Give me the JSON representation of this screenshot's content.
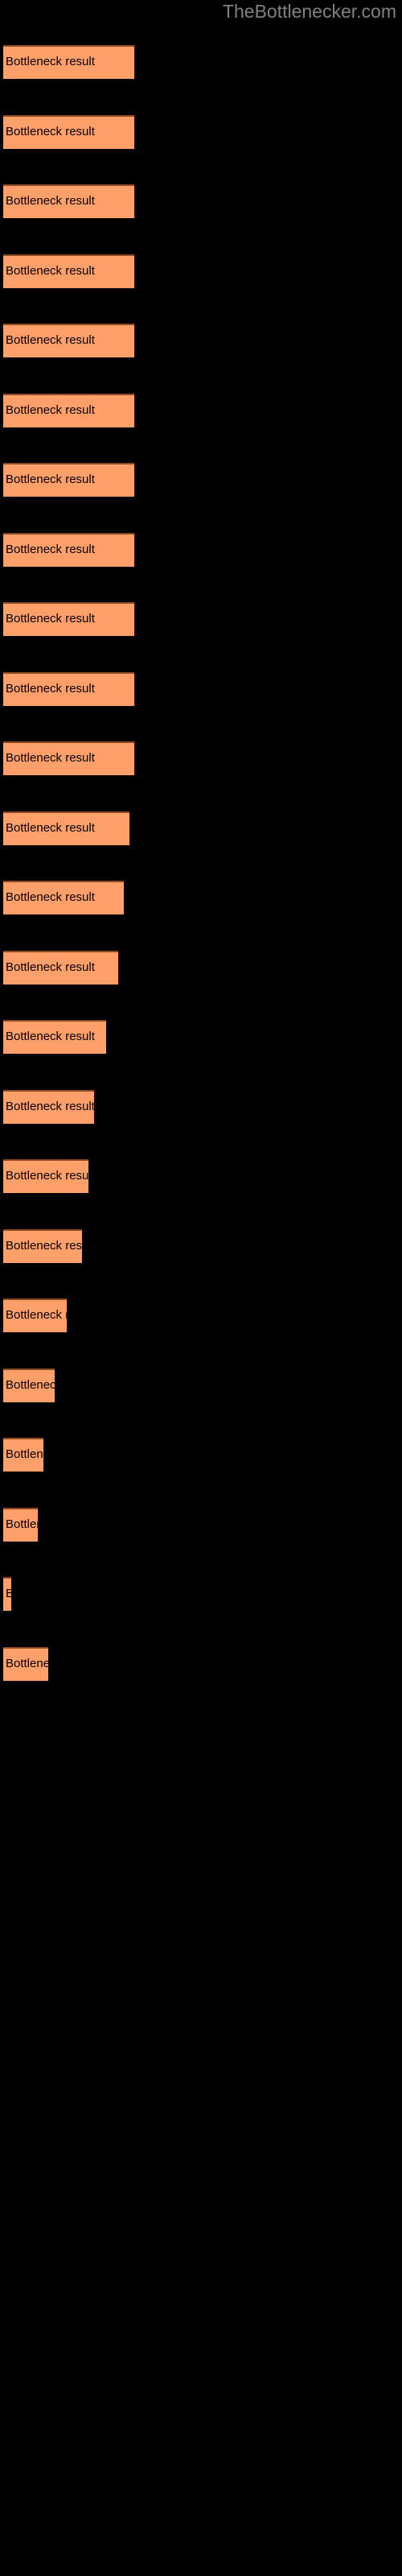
{
  "site": {
    "title": "TheBottlenecker.com",
    "title_color": "#808080",
    "background_color": "#000000"
  },
  "chart_data": {
    "type": "bar",
    "orientation": "horizontal",
    "title": "TheBottlenecker.com",
    "xlabel": "",
    "ylabel": "",
    "bar_color": "#FFA06A",
    "bar_border_color": "#8C4A1E",
    "label_color": "#000000",
    "grid": false,
    "legend": null,
    "axis_visible": false,
    "categories": [
      "Bottleneck result",
      "Bottleneck result",
      "Bottleneck result",
      "Bottleneck result",
      "Bottleneck result",
      "Bottleneck result",
      "Bottleneck result",
      "Bottleneck result",
      "Bottleneck result",
      "Bottleneck result",
      "Bottleneck result",
      "Bottleneck result",
      "Bottleneck result",
      "Bottleneck result",
      "Bottleneck result",
      "Bottleneck result",
      "Bottleneck result",
      "Bottleneck result",
      "Bottleneck result",
      "Bottleneck result",
      "Bottleneck result",
      "Bottleneck result",
      "Bottleneck result",
      "Bottleneck result"
    ],
    "values": [
      163,
      163,
      163,
      163,
      163,
      163,
      163,
      163,
      163,
      163,
      163,
      157,
      150,
      143,
      128,
      113,
      106,
      98,
      79,
      64,
      50,
      43,
      10,
      56
    ],
    "xlim": [
      0,
      500
    ],
    "bars": [
      {
        "label": "Bottleneck result",
        "width": 163,
        "top": 56
      },
      {
        "label": "Bottleneck result",
        "width": 163,
        "top": 143
      },
      {
        "label": "Bottleneck result",
        "width": 163,
        "top": 229
      },
      {
        "label": "Bottleneck result",
        "width": 163,
        "top": 316
      },
      {
        "label": "Bottleneck result",
        "width": 163,
        "top": 402
      },
      {
        "label": "Bottleneck result",
        "width": 163,
        "top": 489
      },
      {
        "label": "Bottleneck result",
        "width": 163,
        "top": 575
      },
      {
        "label": "Bottleneck result",
        "width": 163,
        "top": 662
      },
      {
        "label": "Bottleneck result",
        "width": 163,
        "top": 748
      },
      {
        "label": "Bottleneck result",
        "width": 163,
        "top": 835
      },
      {
        "label": "Bottleneck result",
        "width": 163,
        "top": 921
      },
      {
        "label": "Bottleneck result",
        "width": 157,
        "top": 1008
      },
      {
        "label": "Bottleneck result",
        "width": 150,
        "top": 1094
      },
      {
        "label": "Bottleneck result",
        "width": 143,
        "top": 1181
      },
      {
        "label": "Bottleneck result",
        "width": 128,
        "top": 1267
      },
      {
        "label": "Bottleneck result",
        "width": 113,
        "top": 1354
      },
      {
        "label": "Bottleneck result",
        "width": 106,
        "top": 1440
      },
      {
        "label": "Bottleneck result",
        "width": 98,
        "top": 1527
      },
      {
        "label": "Bottleneck result",
        "width": 79,
        "top": 1613
      },
      {
        "label": "Bottleneck result",
        "width": 64,
        "top": 1700
      },
      {
        "label": "Bottleneck result",
        "width": 50,
        "top": 1786
      },
      {
        "label": "Bottleneck result",
        "width": 43,
        "top": 1873
      },
      {
        "label": "Bottleneck result",
        "width": 10,
        "top": 1959
      },
      {
        "label": "Bottleneck result",
        "width": 56,
        "top": 2046
      }
    ]
  }
}
